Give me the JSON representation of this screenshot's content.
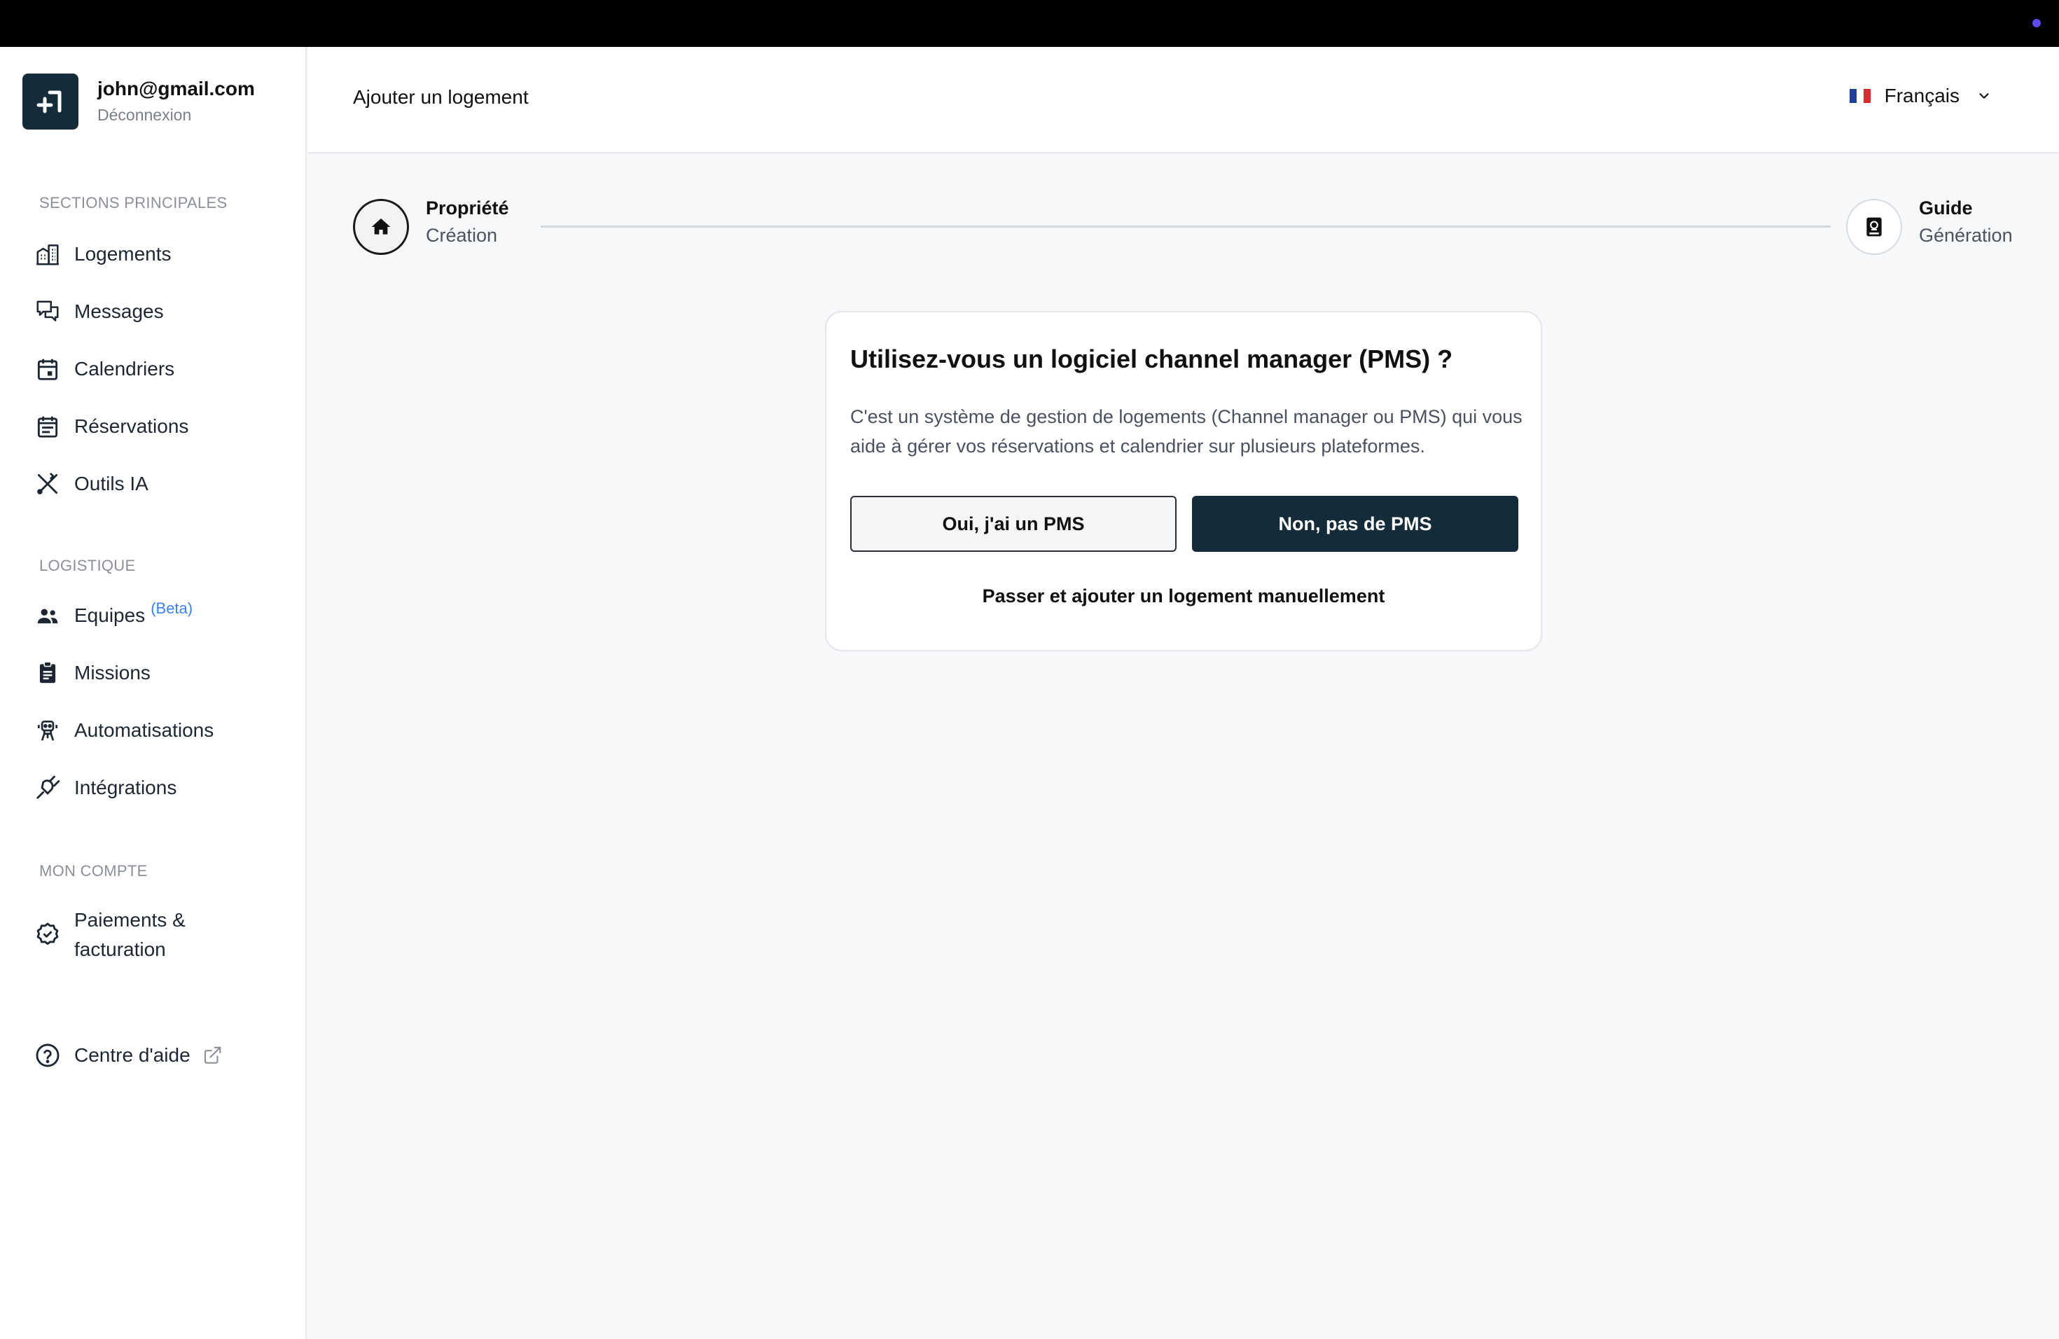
{
  "account": {
    "email": "john@gmail.com",
    "logout_label": "Déconnexion"
  },
  "sidebar": {
    "sections": [
      {
        "title": "SECTIONS PRINCIPALES",
        "items": [
          {
            "label": "Logements",
            "icon": "building-icon"
          },
          {
            "label": "Messages",
            "icon": "chat-bubbles-icon"
          },
          {
            "label": "Calendriers",
            "icon": "calendar-icon"
          },
          {
            "label": "Réservations",
            "icon": "reservation-list-icon"
          },
          {
            "label": "Outils IA",
            "icon": "tools-icon"
          }
        ]
      },
      {
        "title": "LOGISTIQUE",
        "items": [
          {
            "label": "Equipes",
            "icon": "team-icon",
            "badge": "(Beta)"
          },
          {
            "label": "Missions",
            "icon": "clipboard-icon"
          },
          {
            "label": "Automatisations",
            "icon": "robot-icon"
          },
          {
            "label": "Intégrations",
            "icon": "plug-icon"
          }
        ]
      },
      {
        "title": "MON COMPTE",
        "items": [
          {
            "label": "Paiements & facturation",
            "icon": "verified-badge-icon"
          },
          {
            "label": "Centre d'aide",
            "icon": "help-circle-icon",
            "trailing_icon": "external-link-icon"
          }
        ]
      }
    ]
  },
  "header": {
    "title": "Ajouter un logement",
    "language": "Français"
  },
  "stepper": {
    "steps": [
      {
        "title": "Propriété",
        "subtitle": "Création",
        "icon": "home-icon",
        "state": "active"
      },
      {
        "title": "Guide",
        "subtitle": "Génération",
        "icon": "guide-book-icon",
        "state": "inactive"
      }
    ]
  },
  "dialog": {
    "title": "Utilisez-vous un logiciel channel manager (PMS) ?",
    "description": "C'est un système de gestion de logements (Channel manager ou PMS) qui vous aide à gérer vos réservations et calendrier sur plusieurs plateformes.",
    "yes_label": "Oui, j'ai un PMS",
    "no_label": "Non, pas de PMS",
    "skip_label": "Passer et ajouter un logement manuellement"
  },
  "colors": {
    "primary_dark": "#142b39",
    "accent_blue": "#3b82f6",
    "topbar": "#000000",
    "indicator_dot": "#5b4cf0"
  }
}
